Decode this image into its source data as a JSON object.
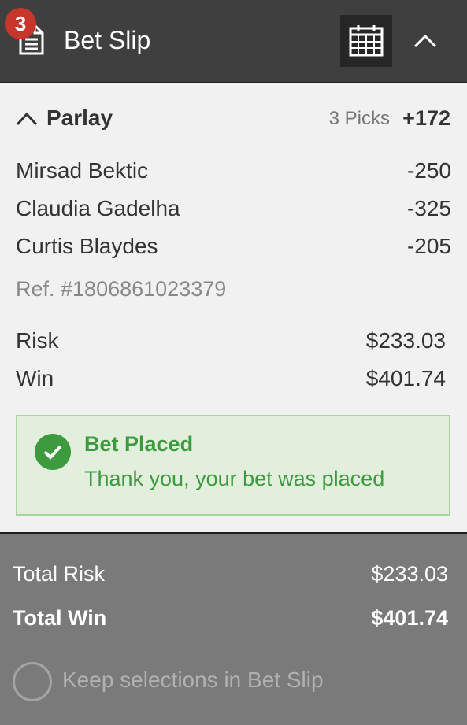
{
  "header": {
    "badge_count": "3",
    "title": "Bet Slip",
    "icons": [
      "bet-slip-icon",
      "calendar-icon",
      "chevron-up-icon"
    ]
  },
  "parlay": {
    "title": "Parlay",
    "picks_count": "3 Picks",
    "odds": "+172",
    "picks": [
      {
        "name": "Mirsad Bektic",
        "odds": "-250"
      },
      {
        "name": "Claudia Gadelha",
        "odds": "-325"
      },
      {
        "name": "Curtis Blaydes",
        "odds": "-205"
      }
    ],
    "ref": "Ref. #1806861023379",
    "risk_label": "Risk",
    "risk_value": "$233.03",
    "win_label": "Win",
    "win_value": "$401.74"
  },
  "alert": {
    "title": "Bet Placed",
    "message": "Thank you, your bet was placed",
    "color": "#3e9a3f"
  },
  "footer": {
    "total_risk_label": "Total Risk",
    "total_risk_value": "$233.03",
    "total_win_label": "Total Win",
    "total_win_value": "$401.74",
    "keep_label": "Keep selections in Bet Slip",
    "keep_checked": false
  },
  "colors": {
    "header_bg": "#3f3f3f",
    "badge": "#c8362b",
    "card_bg": "#f1f1f1",
    "footer_bg": "#7a7a7a"
  }
}
